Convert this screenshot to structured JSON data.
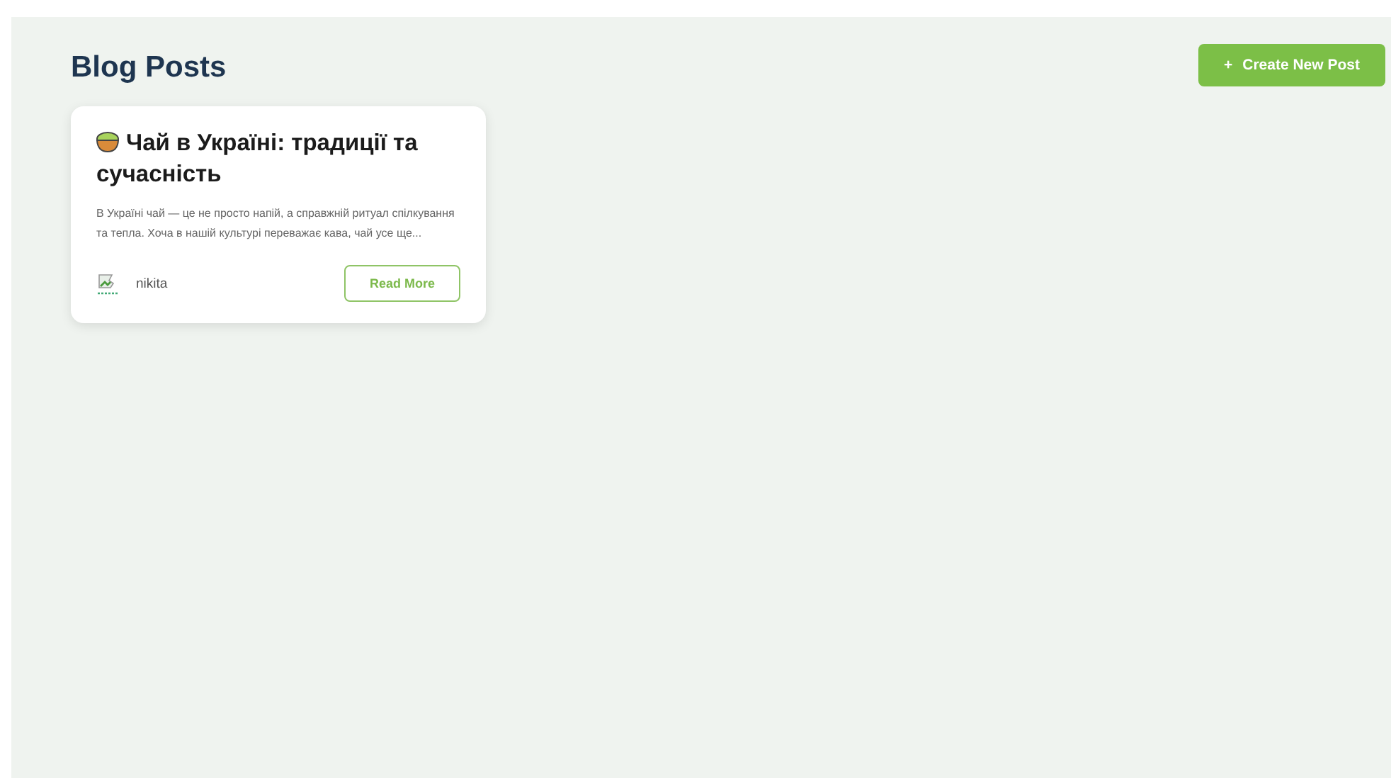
{
  "header": {
    "title": "Blog Posts",
    "create_button": {
      "icon": "+",
      "label": "Create New Post"
    }
  },
  "posts": [
    {
      "title": "Чай в Україні: традиції та сучасність",
      "excerpt": "В Україні чай — це не просто напій, а справжній ритуал спілкування та тепла. Хоча в нашій культурі переважає кава, чай усе ще...",
      "author": "nikita",
      "button": "Read More"
    }
  ]
}
